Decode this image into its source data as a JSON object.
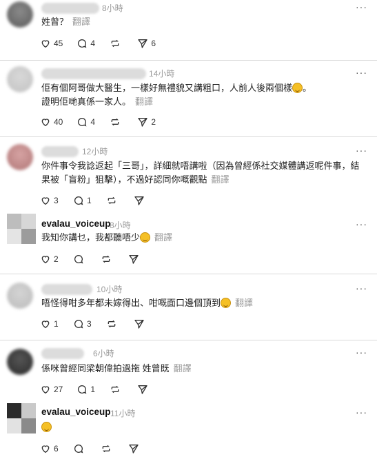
{
  "more_label": "···",
  "translate_label": "翻譯",
  "replies": [
    {
      "time": "8小時",
      "body": "姓曾？",
      "likes": "45",
      "comments": "4",
      "reposts": "",
      "shares": "6"
    },
    {
      "time": "14小時",
      "body_line1": "佢有個阿哥做大醫生，一樣好無禮貌又講粗口，人前人後兩個樣",
      "body_line1_end": "。",
      "body_line2": "證明佢哋真係一家人。",
      "likes": "40",
      "comments": "4",
      "reposts": "",
      "shares": "2"
    },
    {
      "time": "12小時",
      "body_line1": "你件事令我諗返起「三哥」，詳細就唔講啦（因為曾經係社交媒體講返呢件事，結",
      "body_line2": "果被「盲粉」狙擊），不過好認同你嘅觀點",
      "likes": "3",
      "comments": "1",
      "reposts": "",
      "shares": ""
    },
    {
      "username": "evalau_voiceup",
      "time": "8小時",
      "body": "我知你講乜，我都聽唔少",
      "likes": "2",
      "comments": "",
      "reposts": "",
      "shares": ""
    },
    {
      "time": "10小時",
      "body": "唔怪得咁多年都未嫁得出、咁嘅面口邊個頂到",
      "likes": "1",
      "comments": "3",
      "reposts": "",
      "shares": ""
    },
    {
      "time": "6小時",
      "body": "係咪曾經同梁朝偉拍過拖 姓曾既",
      "likes": "27",
      "comments": "1",
      "reposts": "",
      "shares": ""
    },
    {
      "username": "evalau_voiceup",
      "time": "11小時",
      "body": "",
      "likes": "6",
      "comments": "",
      "reposts": "",
      "shares": ""
    }
  ]
}
